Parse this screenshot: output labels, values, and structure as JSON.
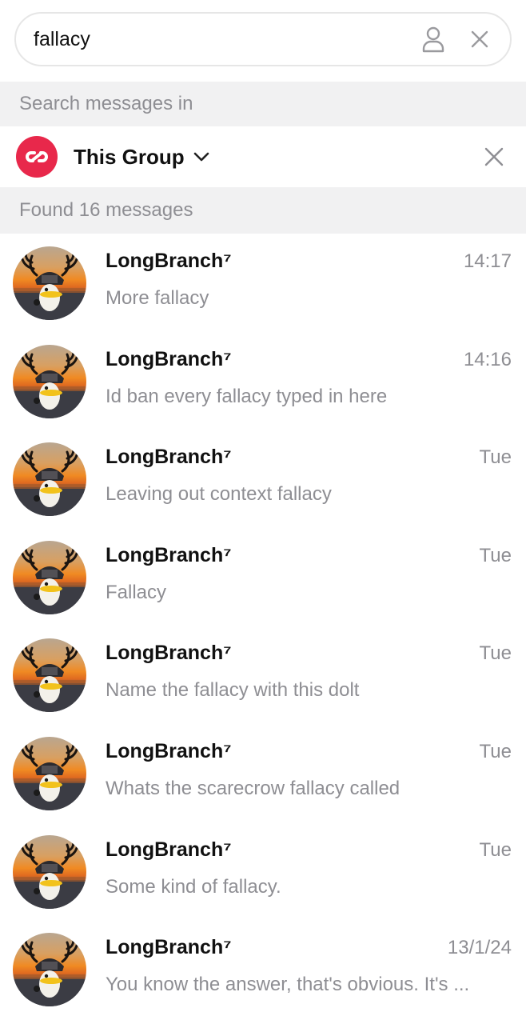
{
  "search": {
    "query": "fallacy"
  },
  "icons": {
    "person": "person-icon",
    "close": "close-icon",
    "chevron": "chevron-down-icon",
    "group_logo": "group-logo-icon"
  },
  "colors": {
    "accent": "#e8284b",
    "section_bg": "#f1f1f2",
    "muted_text": "#8e8e93"
  },
  "scope": {
    "header": "Search messages in",
    "label": "This Group"
  },
  "results": {
    "header": "Found 16 messages",
    "items": [
      {
        "name": "LongBranch⁷",
        "time": "14:17",
        "text": "More fallacy"
      },
      {
        "name": "LongBranch⁷",
        "time": "14:16",
        "text": "Id ban every fallacy typed in here"
      },
      {
        "name": "LongBranch⁷",
        "time": "Tue",
        "text": "Leaving out context fallacy"
      },
      {
        "name": "LongBranch⁷",
        "time": "Tue",
        "text": "Fallacy"
      },
      {
        "name": "LongBranch⁷",
        "time": "Tue",
        "text": "Name the fallacy with this dolt"
      },
      {
        "name": "LongBranch⁷",
        "time": "Tue",
        "text": "Whats the scarecrow fallacy called"
      },
      {
        "name": "LongBranch⁷",
        "time": "Tue",
        "text": "Some kind of fallacy."
      },
      {
        "name": "LongBranch⁷",
        "time": "13/1/24",
        "text": "You know the answer, that's obvious.  It's ..."
      }
    ]
  }
}
